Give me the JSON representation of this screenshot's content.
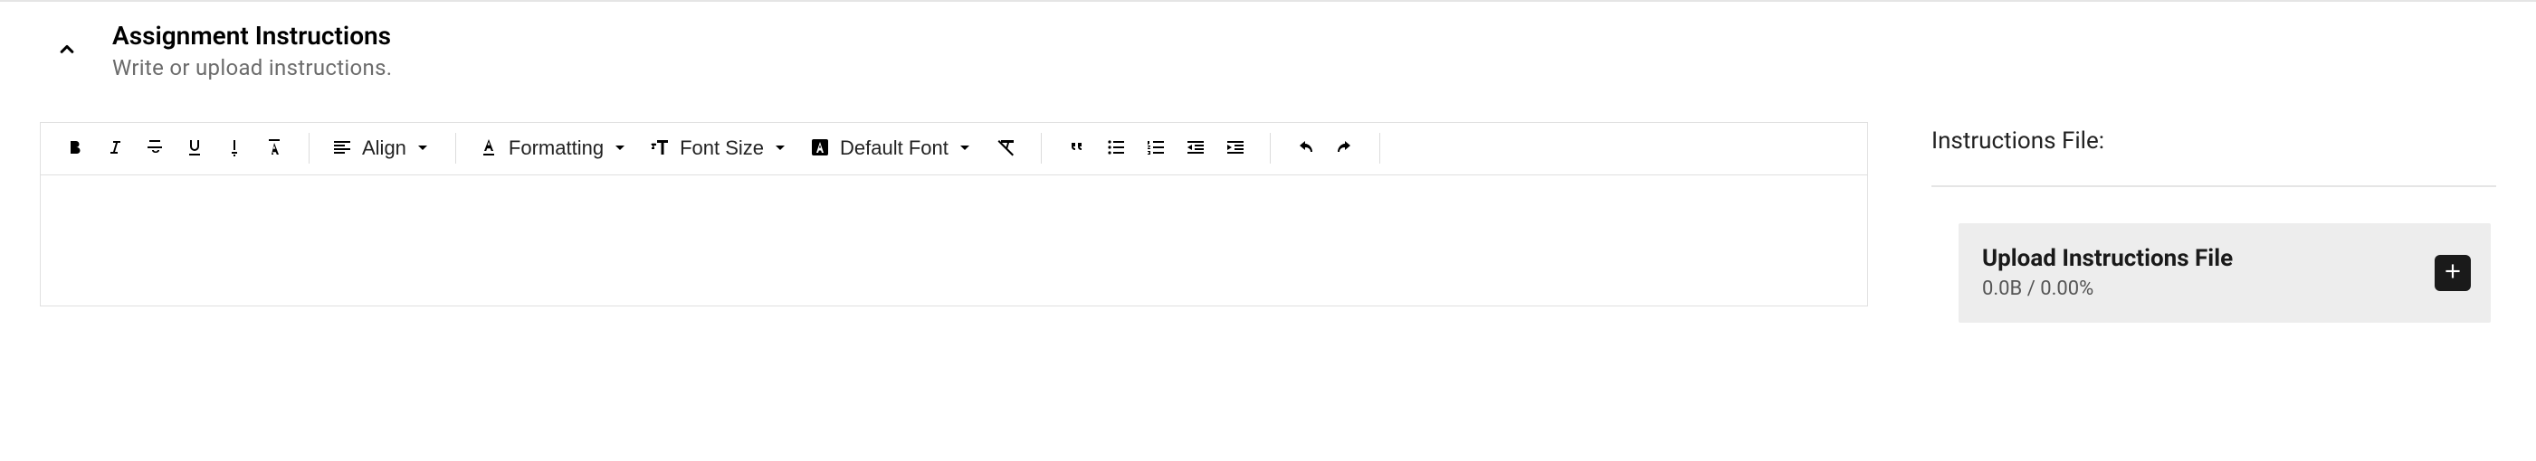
{
  "header": {
    "title": "Assignment Instructions",
    "subtitle": "Write or upload instructions."
  },
  "toolbar": {
    "align_label": "Align",
    "formatting_label": "Formatting",
    "font_size_label": "Font Size",
    "default_font_label": "Default Font"
  },
  "side": {
    "title": "Instructions File:",
    "upload_title": "Upload Instructions File",
    "upload_status": "0.0B / 0.00%"
  }
}
